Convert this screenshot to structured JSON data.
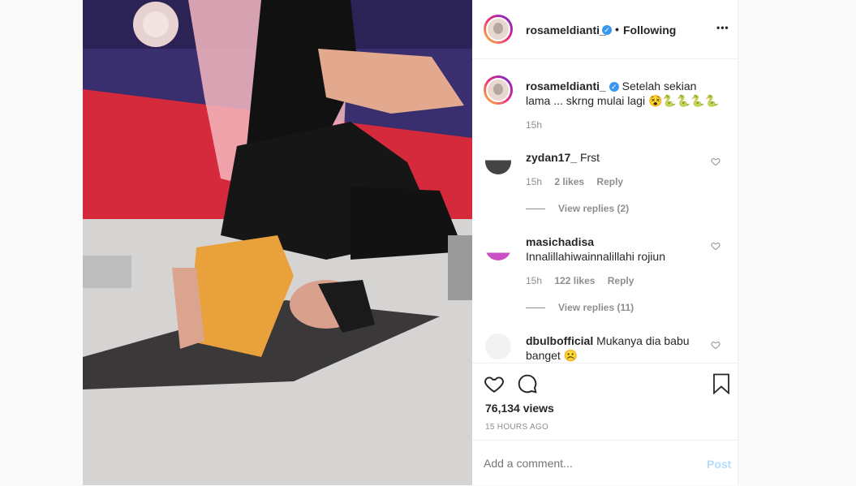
{
  "header": {
    "username": "rosameldianti_",
    "follow_status": "Following",
    "more_glyph": "•••"
  },
  "caption": {
    "username": "rosameldianti_",
    "text": "Setelah sekian lama ... skrng mulai lagi 😵🐍🐍🐍🐍",
    "time": "15h"
  },
  "comments": [
    {
      "username": "zydan17_",
      "text": "Frst",
      "time": "15h",
      "likes": "2 likes",
      "reply": "Reply",
      "view_replies": "View replies (2)"
    },
    {
      "username": "masichadisa",
      "text": "Innalillahiwainnalillahi rojiun",
      "time": "15h",
      "likes": "122 likes",
      "reply": "Reply",
      "view_replies": "View replies (11)"
    },
    {
      "username": "dbulbofficial",
      "text": "Mukanya dia babu banget ☹️"
    }
  ],
  "stats": {
    "views": "76,134 views",
    "posted": "15 HOURS AGO"
  },
  "add_comment": {
    "placeholder": "Add a comment...",
    "post_label": "Post"
  },
  "colors": {
    "accent": "#3897f0",
    "post_disabled": "#b2dffc",
    "muted": "#8e8e8e"
  },
  "icons": [
    "verified-icon",
    "more-options-icon",
    "heart-icon",
    "comment-icon",
    "bookmark-icon"
  ]
}
